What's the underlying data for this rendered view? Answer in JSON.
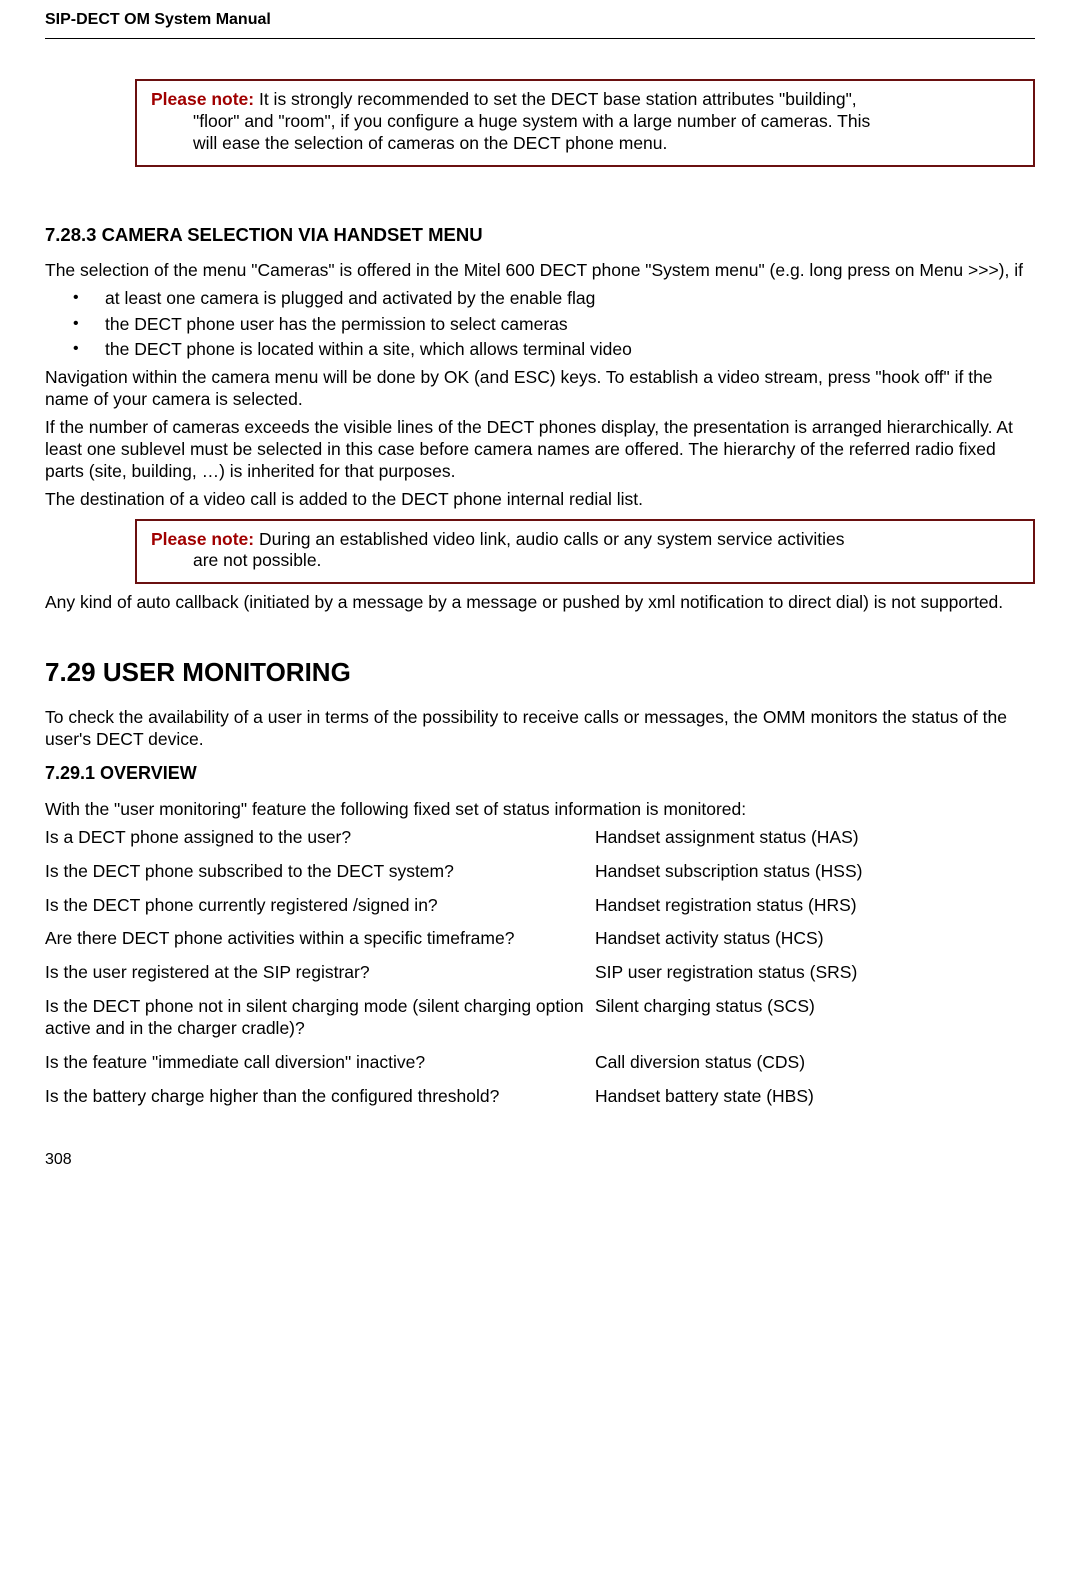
{
  "header": {
    "title": "SIP-DECT OM System Manual"
  },
  "note1": {
    "lead": "Please note:",
    "line1_after": " It is strongly recommended to set the DECT base station attributes \"building\",",
    "line2": "\"floor\" and \"room\", if you configure a huge system with a large number of cameras. This",
    "line3": "will ease the selection of cameras on the DECT phone menu."
  },
  "sec7283": {
    "heading": "7.28.3 CAMERA SELECTION VIA HANDSET MENU",
    "p1": "The selection of the menu \"Cameras\" is offered in the Mitel 600 DECT phone \"System menu\" (e.g. long press on Menu >>>), if",
    "b1": "at least one camera is plugged and activated by the enable flag",
    "b2": "the DECT phone user has the permission to select cameras",
    "b3": "the DECT phone is located within a site, which allows terminal video",
    "p2": "Navigation within the camera menu will be done by OK (and ESC) keys. To establish a video stream, press \"hook off\" if the name of your camera is selected.",
    "p3": "If the number of cameras exceeds the visible lines of the DECT phones display, the presentation is arranged hierarchically. At least one sublevel must be selected in this case before camera names are offered. The hierarchy of the referred radio fixed parts (site, building, …) is inherited for that purposes.",
    "p4": "The destination of a video call is added to the DECT phone internal redial list."
  },
  "note2": {
    "lead": "Please note:",
    "line1_after": " During an established video link, audio calls or any system service activities",
    "line2": "are not possible."
  },
  "p_after_note2": "Any kind of auto callback (initiated by a message by a message or pushed by xml notification to direct dial) is not supported.",
  "sec729": {
    "heading": "7.29 USER MONITORING",
    "intro": "To check the availability of a user in terms of the possibility to receive calls or messages, the OMM monitors the status of the user's DECT device."
  },
  "sec7291": {
    "heading": "7.29.1 OVERVIEW",
    "intro": "With the \"user monitoring\" feature the following fixed set of status information is monitored:",
    "rows": [
      {
        "q": "Is a DECT phone assigned to the user?",
        "a": "Handset assignment status (HAS)"
      },
      {
        "q": "Is the DECT phone subscribed to the DECT system?",
        "a": "Handset subscription status (HSS)"
      },
      {
        "q": "Is the DECT phone currently registered /signed in?",
        "a": "Handset registration status (HRS)"
      },
      {
        "q": "Are there DECT phone activities within a specific timeframe?",
        "a": "Handset activity status (HCS)"
      },
      {
        "q": "Is the user registered at the SIP registrar?",
        "a": "SIP user registration status (SRS)"
      },
      {
        "q": "Is the DECT phone not in silent charging mode (silent charging option active and in the charger cradle)?",
        "a": "Silent charging status (SCS)"
      },
      {
        "q": "Is the feature \"immediate call diversion\" inactive?",
        "a": "Call diversion status (CDS)"
      },
      {
        "q": "Is the battery charge higher than the configured threshold?",
        "a": "Handset battery state (HBS)"
      }
    ]
  },
  "page_number": "308"
}
